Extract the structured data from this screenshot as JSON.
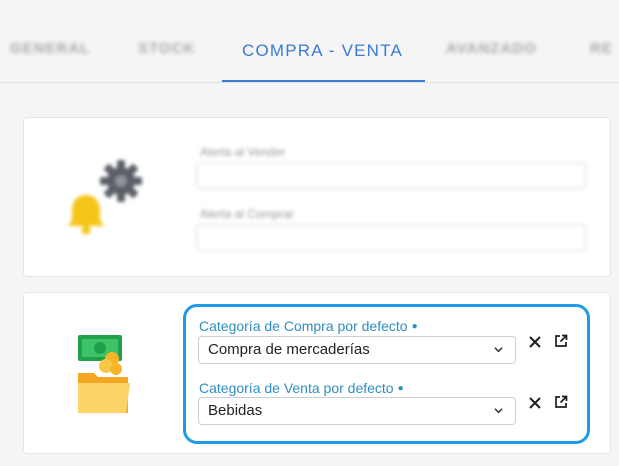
{
  "tabs": [
    {
      "label": "GENERAL",
      "active": false
    },
    {
      "label": "STOCK",
      "active": false
    },
    {
      "label": "COMPRA - VENTA",
      "active": true
    },
    {
      "label": "AVANZADO",
      "active": false
    },
    {
      "label": "RE",
      "active": false
    }
  ],
  "alerts": {
    "sell_label": "Alerta al Vender",
    "buy_label": "Alerta al Comprar",
    "sell_value": "",
    "buy_value": ""
  },
  "categories": {
    "purchase_label": "Categoría de Compra por defecto",
    "purchase_value": "Compra de mercaderías",
    "sale_label": "Categoría de Venta por defecto",
    "sale_value": "Bebidas",
    "required_marker": "●"
  },
  "icons": {
    "gear": "gear-icon",
    "bell": "bell-icon",
    "money": "money-folder-icon",
    "clear": "close-icon",
    "open": "external-link-icon",
    "chevron": "chevron-down-icon"
  },
  "colors": {
    "accent": "#3b7bd4",
    "highlight": "#1f9be5",
    "label": "#2d8fbf"
  }
}
